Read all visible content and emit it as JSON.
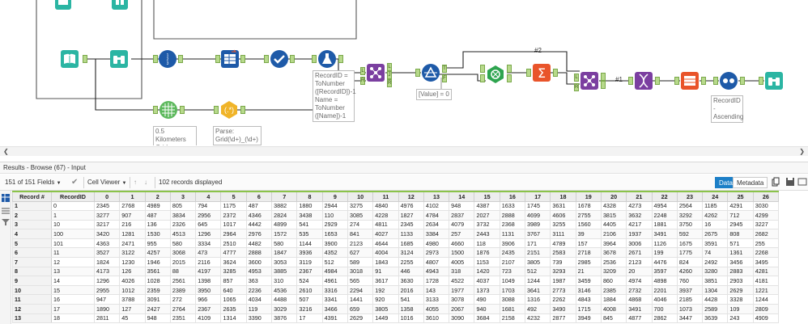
{
  "canvas": {
    "annotations": {
      "grid_tool": "0.5 Kilometers\nGrid",
      "parse_tool": "Parse:\nGrid(\\d+)_(\\d+)",
      "formula_tool": "RecordID =\nToNumber\n([RecordID])-1\nName =\nToNumber\n([Name])-1",
      "filter_tool": "[Value] = 0",
      "sort_tool": "RecordID -\nAscending"
    },
    "wire_labels": {
      "hash2": "#2",
      "hash1": "#1"
    },
    "connector_labels": {
      "j": "J",
      "r": "R",
      "l": "L",
      "t": "T",
      "f": "F",
      "d": "D"
    }
  },
  "results": {
    "title": "Results - Browse (67) - Input",
    "fields_dropdown": "151 of 151 Fields",
    "viewer_dropdown": "Cell Viewer",
    "records_displayed": "102 records displayed",
    "tab_data": "Data",
    "tab_metadata": "Metadata"
  },
  "grid": {
    "headers": [
      "Record #",
      "RecordID",
      "0",
      "1",
      "2",
      "3",
      "4",
      "5",
      "6",
      "7",
      "8",
      "9",
      "10",
      "11",
      "12",
      "13",
      "14",
      "15",
      "16",
      "17",
      "18",
      "19",
      "20",
      "21",
      "22",
      "23",
      "24",
      "25",
      "26"
    ],
    "rows": [
      [
        "1",
        "0",
        "2345",
        "2768",
        "4989",
        "805",
        "794",
        "1175",
        "487",
        "3882",
        "1880",
        "2944",
        "3275",
        "4840",
        "4976",
        "4102",
        "948",
        "4387",
        "1633",
        "1745",
        "3631",
        "1678",
        "4328",
        "4273",
        "4954",
        "2564",
        "1185",
        "4291",
        "3030"
      ],
      [
        "2",
        "1",
        "3277",
        "907",
        "487",
        "3834",
        "2956",
        "2372",
        "4346",
        "2824",
        "3438",
        "110",
        "3085",
        "4228",
        "1827",
        "4784",
        "2837",
        "2027",
        "2888",
        "4699",
        "4606",
        "2755",
        "3815",
        "3632",
        "2248",
        "3292",
        "4262",
        "712",
        "4299",
        "4505"
      ],
      [
        "3",
        "10",
        "3217",
        "216",
        "136",
        "2326",
        "645",
        "1017",
        "4442",
        "4899",
        "541",
        "2929",
        "274",
        "4811",
        "2345",
        "2634",
        "4079",
        "3732",
        "2368",
        "3989",
        "3255",
        "1560",
        "4405",
        "4217",
        "1881",
        "3750",
        "16",
        "2945",
        "3227",
        "346"
      ],
      [
        "4",
        "100",
        "3420",
        "1281",
        "1530",
        "4513",
        "1296",
        "2964",
        "2976",
        "1572",
        "535",
        "1653",
        "841",
        "4027",
        "1133",
        "3384",
        "257",
        "2443",
        "1131",
        "3767",
        "3111",
        "39",
        "2106",
        "1937",
        "3491",
        "592",
        "2675",
        "808",
        "2682",
        "4265"
      ],
      [
        "5",
        "101",
        "4363",
        "2471",
        "955",
        "580",
        "3334",
        "2510",
        "4482",
        "580",
        "1144",
        "3900",
        "2123",
        "4644",
        "1685",
        "4980",
        "4660",
        "118",
        "3906",
        "171",
        "4789",
        "157",
        "3964",
        "3006",
        "1126",
        "1675",
        "3591",
        "571",
        "255",
        "560"
      ],
      [
        "6",
        "11",
        "3527",
        "3122",
        "4257",
        "3068",
        "473",
        "4777",
        "2888",
        "1847",
        "3936",
        "4352",
        "627",
        "4004",
        "3124",
        "2973",
        "1500",
        "1876",
        "2435",
        "2151",
        "2583",
        "2718",
        "3678",
        "2671",
        "199",
        "1775",
        "74",
        "1361",
        "2268",
        "1974"
      ],
      [
        "7",
        "12",
        "1824",
        "1230",
        "1946",
        "2015",
        "2116",
        "3624",
        "3600",
        "3053",
        "3119",
        "512",
        "589",
        "1843",
        "2255",
        "4807",
        "4005",
        "1153",
        "2107",
        "3805",
        "739",
        "2985",
        "2536",
        "2123",
        "4476",
        "824",
        "2492",
        "3456",
        "3495",
        "222"
      ],
      [
        "8",
        "13",
        "4173",
        "126",
        "3561",
        "88",
        "4197",
        "3285",
        "4953",
        "3885",
        "2367",
        "4984",
        "3018",
        "91",
        "446",
        "4943",
        "318",
        "1420",
        "723",
        "512",
        "3293",
        "21",
        "3209",
        "20",
        "3597",
        "4260",
        "3280",
        "2883",
        "4281",
        "473"
      ],
      [
        "9",
        "14",
        "1296",
        "4026",
        "1028",
        "2561",
        "1398",
        "857",
        "363",
        "310",
        "524",
        "4961",
        "565",
        "3617",
        "3630",
        "1728",
        "4522",
        "4037",
        "1049",
        "1244",
        "1987",
        "3459",
        "860",
        "4974",
        "4898",
        "760",
        "3851",
        "2903",
        "4181",
        "3479"
      ],
      [
        "10",
        "15",
        "2955",
        "1012",
        "2359",
        "2389",
        "3950",
        "640",
        "2236",
        "4536",
        "2610",
        "3316",
        "2294",
        "192",
        "2016",
        "143",
        "1977",
        "1373",
        "1703",
        "3641",
        "2773",
        "3146",
        "2385",
        "2732",
        "2201",
        "3937",
        "1304",
        "2629",
        "1221",
        "2898"
      ],
      [
        "11",
        "16",
        "947",
        "3788",
        "3091",
        "272",
        "966",
        "1065",
        "4034",
        "4488",
        "507",
        "3341",
        "1441",
        "920",
        "541",
        "3133",
        "3078",
        "490",
        "3088",
        "1316",
        "2262",
        "4843",
        "1884",
        "4868",
        "4046",
        "2185",
        "4428",
        "3328",
        "1244",
        "3181"
      ],
      [
        "12",
        "17",
        "1890",
        "127",
        "2427",
        "2764",
        "2367",
        "2635",
        "119",
        "3029",
        "3216",
        "3466",
        "659",
        "3805",
        "1358",
        "4055",
        "2067",
        "940",
        "1681",
        "492",
        "3490",
        "1715",
        "4008",
        "3491",
        "700",
        "1073",
        "2589",
        "109",
        "2809",
        "4698"
      ],
      [
        "13",
        "18",
        "2811",
        "45",
        "948",
        "2351",
        "4109",
        "1314",
        "3390",
        "3876",
        "17",
        "4391",
        "2629",
        "1449",
        "1016",
        "3610",
        "3090",
        "3684",
        "2158",
        "4232",
        "2877",
        "3949",
        "845",
        "4877",
        "2862",
        "3447",
        "3639",
        "243",
        "4909",
        "1385"
      ]
    ]
  }
}
